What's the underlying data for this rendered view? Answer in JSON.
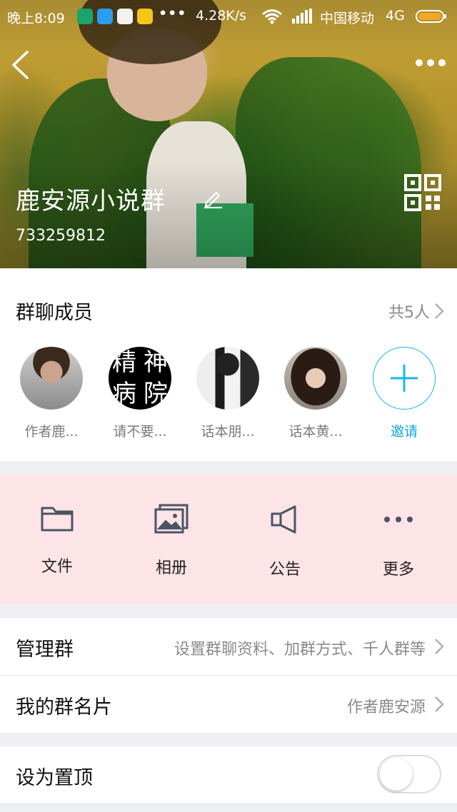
{
  "status_bar": {
    "time": "晚上8:09",
    "more_dots": "•••",
    "speed": "4.28K/s",
    "carrier": "中国移动",
    "network": "4G"
  },
  "header": {
    "group_name": "鹿安源小说群",
    "group_id": "733259812",
    "icons": [
      "back-icon",
      "more-icon",
      "edit-icon",
      "qr-code-icon"
    ]
  },
  "members": {
    "title": "群聊成员",
    "count": "共5人",
    "list": [
      {
        "name": "作者鹿..."
      },
      {
        "name": "请不要..."
      },
      {
        "name": "话本朋..."
      },
      {
        "name": "话本黄..."
      }
    ],
    "invite_label": "邀请",
    "avatar2_text": [
      "精",
      "神",
      "病",
      "院"
    ]
  },
  "shortcuts": [
    {
      "label": "文件",
      "icon": "folder-icon"
    },
    {
      "label": "相册",
      "icon": "album-icon"
    },
    {
      "label": "公告",
      "icon": "megaphone-icon"
    },
    {
      "label": "更多",
      "icon": "more-icon"
    }
  ],
  "settings": {
    "manage": {
      "label": "管理群",
      "value": "设置群聊资料、加群方式、千人群等"
    },
    "card": {
      "label": "我的群名片",
      "value": "作者鹿安源"
    },
    "pin": {
      "label": "设为置顶",
      "enabled": false
    }
  },
  "colors": {
    "accent": "#12b7f5",
    "shortcut_bg": "#fde4e6"
  }
}
